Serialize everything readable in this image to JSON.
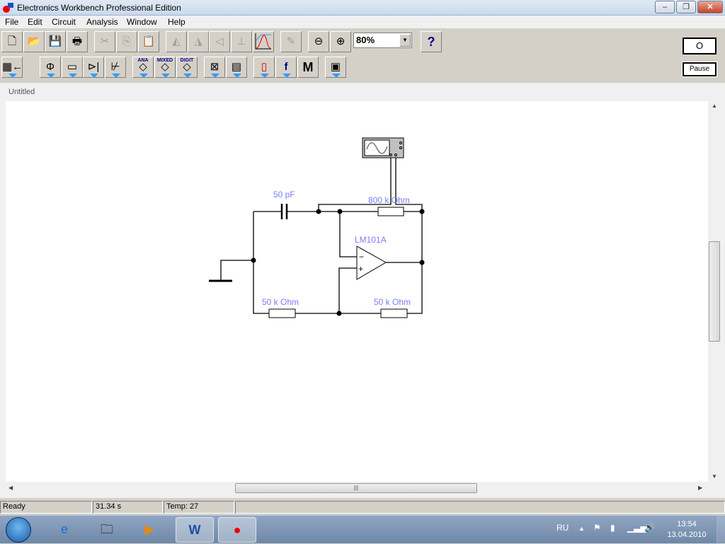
{
  "window": {
    "title": "Electronics Workbench Professional Edition",
    "minimize": "–",
    "restore": "❐",
    "close": "✕"
  },
  "menu": [
    "File",
    "Edit",
    "Circuit",
    "Analysis",
    "Window",
    "Help"
  ],
  "toolbar": {
    "zoom_value": "80%",
    "help_label": "?",
    "power_label": "O",
    "pause_label": "Pause",
    "parts_bins": {
      "analog_ics": "ANA",
      "mixed_ics": "MIXED",
      "digital_ics": "DIGIT",
      "misc": "M"
    }
  },
  "document": {
    "title": "Untitled"
  },
  "circuit": {
    "wire_color": "#000000",
    "label_color": "#7b7bff",
    "capacitor": "50 pF",
    "feedback_resistor": "800 k Ohm",
    "opamp": "LM101A",
    "resistor_left": "50 k Ohm",
    "resistor_right": "50 k Ohm",
    "opamp_minus": "−",
    "opamp_plus": "+"
  },
  "status": {
    "state": "Ready",
    "time": "31.34 s",
    "temp": "Temp:  27"
  },
  "taskbar": {
    "language": "RU",
    "time": "13:54",
    "date": "13.04.2010"
  }
}
